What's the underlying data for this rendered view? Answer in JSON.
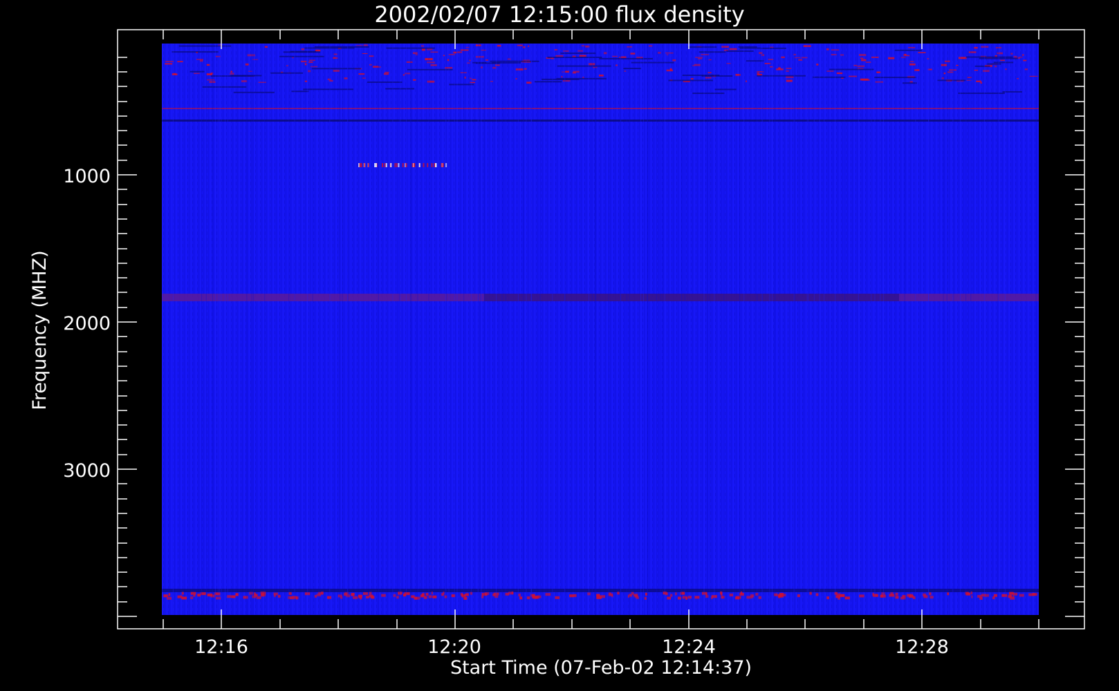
{
  "chart_data": {
    "type": "heatmap",
    "title": "2002/02/07 12:15:00 flux density",
    "xlabel": "Start Time (07-Feb-02 12:14:37)",
    "ylabel": "Frequency (MHZ)",
    "x_ticks": [
      "12:16",
      "12:20",
      "12:24",
      "12:28"
    ],
    "y_ticks": [
      "1000",
      "2000",
      "3000"
    ],
    "colors": {
      "background": "#000000",
      "axes": "#ffffff",
      "field": "#1414f2",
      "feature_red": "#d01030",
      "feature_dark": "#0a0a7a"
    }
  }
}
